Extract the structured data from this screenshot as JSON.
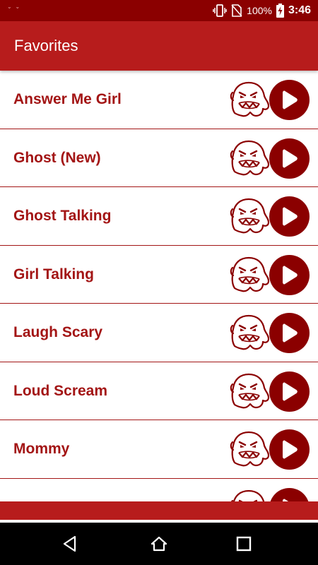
{
  "status_bar": {
    "battery": "100%",
    "time": "3:46",
    "icons": [
      "vibrate-icon",
      "no-sim-icon",
      "battery-charging-icon"
    ]
  },
  "app_bar": {
    "title": "Favorites"
  },
  "favorites": [
    {
      "label": "Answer Me Girl"
    },
    {
      "label": "Ghost (New)"
    },
    {
      "label": "Ghost Talking"
    },
    {
      "label": "Girl Talking"
    },
    {
      "label": "Laugh Scary"
    },
    {
      "label": "Loud Scream"
    },
    {
      "label": "Mommy"
    },
    {
      "label": ""
    }
  ],
  "row_icons": {
    "ghost": "ghost-icon",
    "play": "play-icon"
  },
  "nav_bar": {
    "icons": [
      "back-icon",
      "home-icon",
      "recents-icon"
    ]
  },
  "colors": {
    "status_bar": "#8b0000",
    "app_bar": "#b71c1c",
    "label_text": "#a31515",
    "play_button": "#8b0000",
    "divider": "#a31515"
  }
}
